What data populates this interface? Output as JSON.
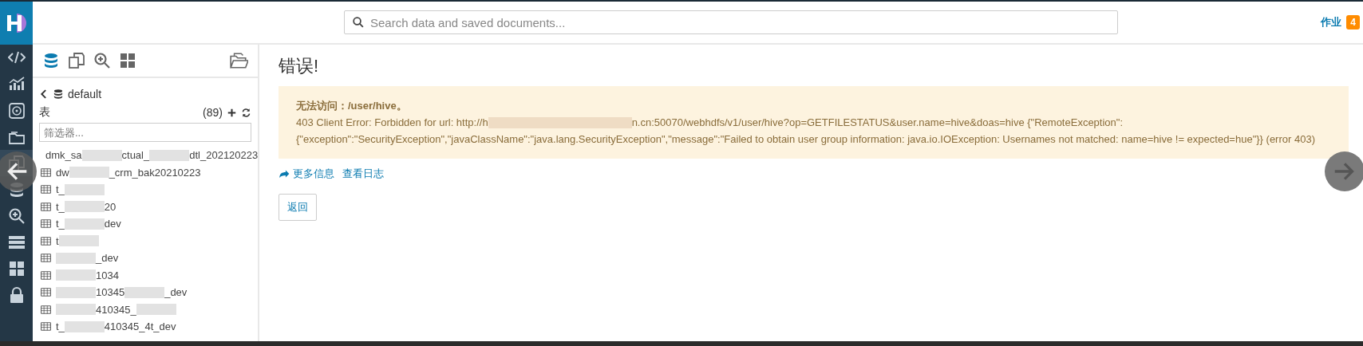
{
  "top_bar": {
    "search": {
      "placeholder": "Search data and saved documents..."
    },
    "jobs": {
      "label": "作业",
      "count": "4"
    }
  },
  "nav_bar": {
    "items": [
      {
        "selected": false
      },
      {
        "selected": false
      },
      {
        "selected": false
      },
      {
        "selected": false
      },
      {
        "selected": true
      },
      {
        "selected": false
      },
      {
        "selected": false
      },
      {
        "selected": false
      },
      {
        "selected": false
      },
      {
        "selected": false
      }
    ]
  },
  "sidebar": {
    "database": "default",
    "section": "表",
    "count": "(89)",
    "filter": {
      "placeholder": "筛选器..."
    },
    "tables": [
      {
        "segments": [
          {
            "kind": "text",
            "text": "dmk_sa"
          },
          {
            "kind": "redacted"
          },
          {
            "kind": "text",
            "text": "ctual_"
          },
          {
            "kind": "redacted"
          },
          {
            "kind": "text",
            "text": "dtl_202120223"
          }
        ]
      },
      {
        "segments": [
          {
            "kind": "text",
            "text": "dw"
          },
          {
            "kind": "redacted"
          },
          {
            "kind": "text",
            "text": "_crm_bak20210223"
          }
        ]
      },
      {
        "segments": [
          {
            "kind": "text",
            "text": "t_"
          },
          {
            "kind": "redacted"
          }
        ]
      },
      {
        "segments": [
          {
            "kind": "text",
            "text": "t_"
          },
          {
            "kind": "redacted"
          },
          {
            "kind": "text",
            "text": "20"
          }
        ]
      },
      {
        "segments": [
          {
            "kind": "text",
            "text": "t_"
          },
          {
            "kind": "redacted"
          },
          {
            "kind": "text",
            "text": "dev"
          }
        ]
      },
      {
        "segments": [
          {
            "kind": "text",
            "text": "t"
          },
          {
            "kind": "redacted"
          }
        ]
      },
      {
        "segments": [
          {
            "kind": "redacted"
          },
          {
            "kind": "text",
            "text": "_dev"
          }
        ]
      },
      {
        "segments": [
          {
            "kind": "redacted"
          },
          {
            "kind": "text",
            "text": "1034"
          }
        ]
      },
      {
        "segments": [
          {
            "kind": "redacted"
          },
          {
            "kind": "text",
            "text": "10345"
          },
          {
            "kind": "redacted"
          },
          {
            "kind": "text",
            "text": "_dev"
          }
        ]
      },
      {
        "segments": [
          {
            "kind": "redacted"
          },
          {
            "kind": "text",
            "text": "410345_"
          },
          {
            "kind": "redacted"
          }
        ]
      },
      {
        "segments": [
          {
            "kind": "text",
            "text": "t_"
          },
          {
            "kind": "redacted"
          },
          {
            "kind": "text",
            "text": "410345_4t_dev"
          }
        ]
      }
    ]
  },
  "main": {
    "title": "错误!",
    "alert": {
      "heading": "无法访问：/user/hive。",
      "message_lines": [
        {
          "segments": [
            {
              "kind": "text",
              "text": "403 Client Error: Forbidden for url: http://h"
            },
            {
              "kind": "redacted"
            },
            {
              "kind": "text",
              "text": "n.cn:50070/webhdfs/v1/user/hive?op=GETFILESTATUS&user.name=hive&doas=hive {\"RemoteException\":"
            }
          ]
        },
        {
          "segments": [
            {
              "kind": "text",
              "text": "{\"exception\":\"SecurityException\",\"javaClassName\":\"java.lang.SecurityException\",\"message\":\"Failed to obtain user group information: java.io.IOException: Usernames not matched: name=hive != expected=hue\"}} (error 403)"
            }
          ]
        }
      ]
    },
    "links": [
      "更多信息",
      "查看日志"
    ],
    "back_button": "返回"
  }
}
